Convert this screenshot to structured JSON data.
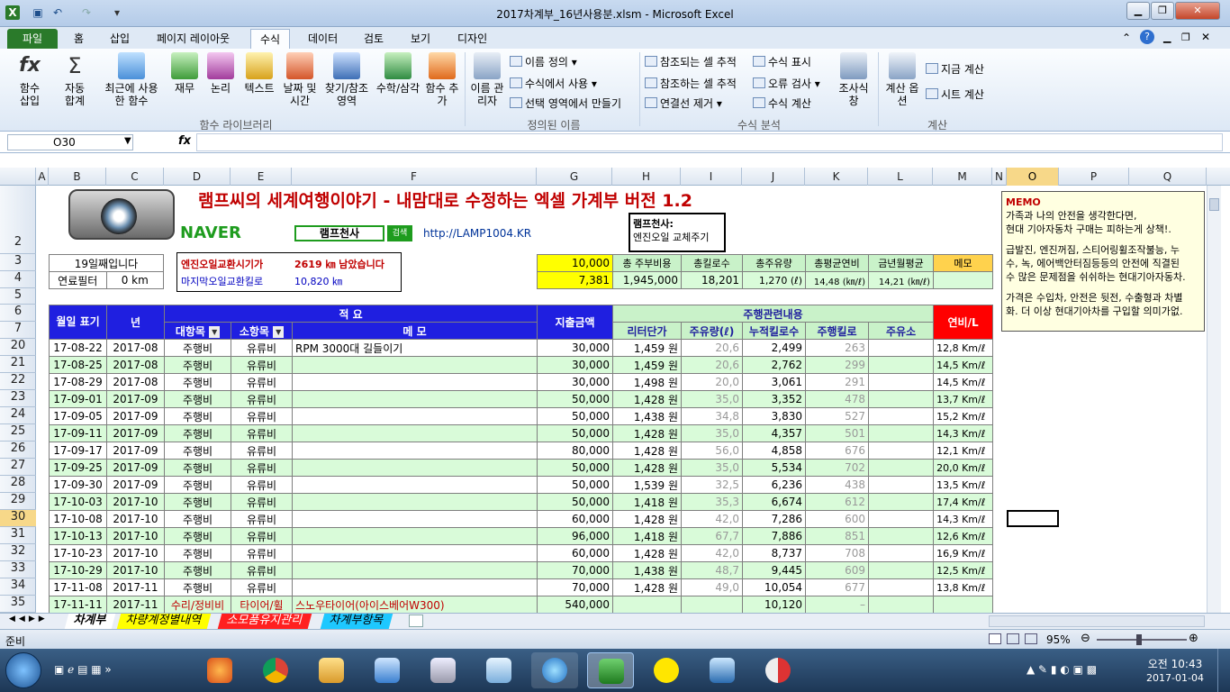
{
  "window": {
    "title": "2017차계부_16년사용분.xlsm  -  Microsoft Excel"
  },
  "ribbon_tabs": [
    "파일",
    "홈",
    "삽입",
    "페이지 레이아웃",
    "수식",
    "데이터",
    "검토",
    "보기",
    "디자인"
  ],
  "ribbon": {
    "fn_insert": "함수 삽입",
    "autosum": "자동 합계",
    "recent": "최근에 사용한 함수",
    "finance": "재무",
    "logic": "논리",
    "text": "텍스트",
    "datetime": "날짜 및 시간",
    "lookup": "찾기/참조 영역",
    "math": "수학/삼각",
    "more": "함수 추가",
    "group_library": "함수 라이브러리",
    "name_mgr": "이름 관리자",
    "define_name": "이름 정의",
    "use_in_formula": "수식에서 사용",
    "create_from_sel": "선택 영역에서 만들기",
    "group_names": "정의된 이름",
    "trace_prec": "참조되는 셀 추적",
    "trace_dep": "참조하는 셀 추적",
    "remove_arrows": "연결선 제거",
    "show_formulas": "수식 표시",
    "error_check": "오류 검사",
    "eval_formula": "수식 계산",
    "watch": "조사식 창",
    "group_audit": "수식 분석",
    "calc_options": "계산 옵션",
    "calc_now": "지금 계산",
    "calc_sheet": "시트 계산",
    "group_calc": "계산"
  },
  "formula_bar": {
    "name_box": "O30",
    "fx": "fx",
    "value": ""
  },
  "columns": [
    "A",
    "B",
    "C",
    "D",
    "E",
    "F",
    "G",
    "H",
    "I",
    "J",
    "K",
    "L",
    "M",
    "N",
    "O",
    "P",
    "Q"
  ],
  "rows": [
    "2",
    "3",
    "4",
    "5",
    "6",
    "7",
    "20",
    "21",
    "22",
    "23",
    "24",
    "25",
    "26",
    "27",
    "28",
    "29",
    "30",
    "31",
    "32",
    "33",
    "34",
    "35"
  ],
  "selected_cell": {
    "col": "O",
    "row": "30"
  },
  "banner": {
    "title": "램프씨의 세계여행이야기 - 내맘대로 수정하는 엑셀 가계부 버전 1.2",
    "naver": "NAVER",
    "search_text": "램프천사",
    "search_btn": "검색",
    "url": "http://LAMP1004.KR"
  },
  "note": {
    "author": "램프천사:",
    "text": "엔진오일 교체주기"
  },
  "memo": {
    "title": "MEMO",
    "lines": [
      "가족과 나의 안전을 생각한다면,",
      "현대 기아자동차 구매는 피하는게 상책!.",
      "",
      "급발진, 엔진꺼짐, 스티어링휠조작불능, 누",
      "수, 녹, 에어백안터짐등등의 안전에 직결된",
      "수 많은 문제점을 쉬쉬하는 현대기아자동차.",
      "",
      "가격은 수입차, 안전은 뒷전, 수출형과 차별",
      "화. 더 이상 현대기아차를 구입할 의미가없."
    ]
  },
  "info": {
    "day_count": "19일째입니다",
    "fuel_filter_label": "연료필터",
    "fuel_filter_val": "0 km",
    "oil_label": "엔진오일교환시기가",
    "oil_remaining": "2619 ㎞ 남았습니다",
    "oil_last_label": "마지막오일교환킬로",
    "oil_last_val": "10,820 ㎞"
  },
  "summary": {
    "g3": "10,000",
    "g4": "7,381",
    "headers": [
      "총 주부비용",
      "총킬로수",
      "총주유량",
      "총평균연비",
      "금년월평균",
      "메모"
    ],
    "values": [
      "1,945,000",
      "18,201",
      "1,270 (ℓ)",
      "14,48 (㎞/ℓ)",
      "14,21 (㎞/ℓ)",
      ""
    ]
  },
  "table_headers": {
    "date": "월일 표기",
    "year": "년",
    "desc_top": "적                요",
    "major": "대항목",
    "minor": "소항목",
    "memo": "메          모",
    "amount": "지출금액",
    "driving": "주행관련내용",
    "unit_price": "리터단가",
    "fuel": "주유량(ℓ)",
    "odo": "누적킬로수",
    "dist": "주행킬로",
    "station": "주유소",
    "eff": "연비/L"
  },
  "table_rows": [
    {
      "row": "20",
      "date": "17-08-22",
      "year": "2017-08",
      "major": "주행비",
      "minor": "유류비",
      "memo": "RPM 3000대 길들이기",
      "amount": "30,000",
      "price": "1,459 원",
      "fuel": "20,6",
      "odo": "2,499",
      "dist": "263",
      "eff": "12,8  Km/ℓ"
    },
    {
      "row": "21",
      "date": "17-08-25",
      "year": "2017-08",
      "major": "주행비",
      "minor": "유류비",
      "memo": "",
      "amount": "30,000",
      "price": "1,459 원",
      "fuel": "20,6",
      "odo": "2,762",
      "dist": "299",
      "eff": "14,5  Km/ℓ"
    },
    {
      "row": "22",
      "date": "17-08-29",
      "year": "2017-08",
      "major": "주행비",
      "minor": "유류비",
      "memo": "",
      "amount": "30,000",
      "price": "1,498 원",
      "fuel": "20,0",
      "odo": "3,061",
      "dist": "291",
      "eff": "14,5  Km/ℓ"
    },
    {
      "row": "23",
      "date": "17-09-01",
      "year": "2017-09",
      "major": "주행비",
      "minor": "유류비",
      "memo": "",
      "amount": "50,000",
      "price": "1,428 원",
      "fuel": "35,0",
      "odo": "3,352",
      "dist": "478",
      "eff": "13,7  Km/ℓ"
    },
    {
      "row": "24",
      "date": "17-09-05",
      "year": "2017-09",
      "major": "주행비",
      "minor": "유류비",
      "memo": "",
      "amount": "50,000",
      "price": "1,438 원",
      "fuel": "34,8",
      "odo": "3,830",
      "dist": "527",
      "eff": "15,2  Km/ℓ"
    },
    {
      "row": "25",
      "date": "17-09-11",
      "year": "2017-09",
      "major": "주행비",
      "minor": "유류비",
      "memo": "",
      "amount": "50,000",
      "price": "1,428 원",
      "fuel": "35,0",
      "odo": "4,357",
      "dist": "501",
      "eff": "14,3  Km/ℓ"
    },
    {
      "row": "26",
      "date": "17-09-17",
      "year": "2017-09",
      "major": "주행비",
      "minor": "유류비",
      "memo": "",
      "amount": "80,000",
      "price": "1,428 원",
      "fuel": "56,0",
      "odo": "4,858",
      "dist": "676",
      "eff": "12,1  Km/ℓ"
    },
    {
      "row": "27",
      "date": "17-09-25",
      "year": "2017-09",
      "major": "주행비",
      "minor": "유류비",
      "memo": "",
      "amount": "50,000",
      "price": "1,428 원",
      "fuel": "35,0",
      "odo": "5,534",
      "dist": "702",
      "eff": "20,0  Km/ℓ"
    },
    {
      "row": "28",
      "date": "17-09-30",
      "year": "2017-09",
      "major": "주행비",
      "minor": "유류비",
      "memo": "",
      "amount": "50,000",
      "price": "1,539 원",
      "fuel": "32,5",
      "odo": "6,236",
      "dist": "438",
      "eff": "13,5  Km/ℓ"
    },
    {
      "row": "29",
      "date": "17-10-03",
      "year": "2017-10",
      "major": "주행비",
      "minor": "유류비",
      "memo": "",
      "amount": "50,000",
      "price": "1,418 원",
      "fuel": "35,3",
      "odo": "6,674",
      "dist": "612",
      "eff": "17,4  Km/ℓ"
    },
    {
      "row": "30",
      "date": "17-10-08",
      "year": "2017-10",
      "major": "주행비",
      "minor": "유류비",
      "memo": "",
      "amount": "60,000",
      "price": "1,428 원",
      "fuel": "42,0",
      "odo": "7,286",
      "dist": "600",
      "eff": "14,3  Km/ℓ"
    },
    {
      "row": "31",
      "date": "17-10-13",
      "year": "2017-10",
      "major": "주행비",
      "minor": "유류비",
      "memo": "",
      "amount": "96,000",
      "price": "1,418 원",
      "fuel": "67,7",
      "odo": "7,886",
      "dist": "851",
      "eff": "12,6  Km/ℓ"
    },
    {
      "row": "32",
      "date": "17-10-23",
      "year": "2017-10",
      "major": "주행비",
      "minor": "유류비",
      "memo": "",
      "amount": "60,000",
      "price": "1,428 원",
      "fuel": "42,0",
      "odo": "8,737",
      "dist": "708",
      "eff": "16,9  Km/ℓ"
    },
    {
      "row": "33",
      "date": "17-10-29",
      "year": "2017-10",
      "major": "주행비",
      "minor": "유류비",
      "memo": "",
      "amount": "70,000",
      "price": "1,438 원",
      "fuel": "48,7",
      "odo": "9,445",
      "dist": "609",
      "eff": "12,5  Km/ℓ"
    },
    {
      "row": "34",
      "date": "17-11-08",
      "year": "2017-11",
      "major": "주행비",
      "minor": "유류비",
      "memo": "",
      "amount": "70,000",
      "price": "1,428 원",
      "fuel": "49,0",
      "odo": "10,054",
      "dist": "677",
      "eff": "13,8  Km/ℓ"
    },
    {
      "row": "35",
      "date": "17-11-11",
      "year": "2017-11",
      "major": "수리/정비비",
      "minor": "타이어/휠",
      "memo": "스노우타이어(아이스베어W300)",
      "amount": "540,000",
      "price": "",
      "fuel": "",
      "odo": "10,120",
      "dist": "–",
      "eff": ""
    }
  ],
  "sheet_tabs": [
    "차계부",
    "차량계정별내역",
    "소모품유지관리",
    "차계부항목"
  ],
  "status": {
    "ready": "준비",
    "zoom": "95%"
  },
  "taskbar": {
    "time": "오전 10:43",
    "date": "2017-01-04"
  },
  "colors": {
    "accent_blue": "#1f1fe0",
    "green_row": "#d9fbd9",
    "red_header": "#ff0000",
    "file_tab": "#2a7a2a"
  }
}
